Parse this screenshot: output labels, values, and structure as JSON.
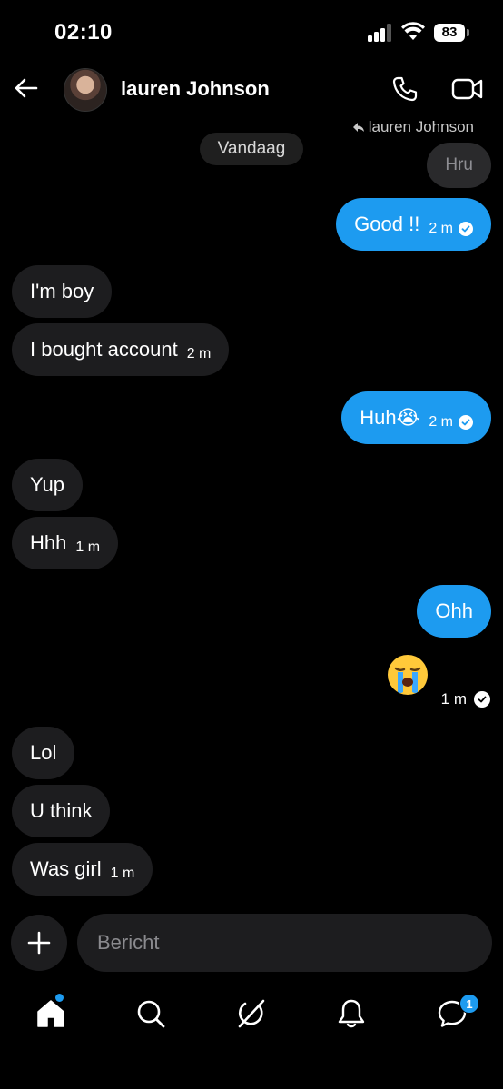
{
  "status": {
    "time": "02:10",
    "battery": "83"
  },
  "header": {
    "name": "lauren Johnson"
  },
  "reply_to": "lauren Johnson",
  "date_separator": "Vandaag",
  "messages": {
    "quoted": "Hru",
    "m1": {
      "text": "Good !!",
      "time": "2 m"
    },
    "m2": {
      "text": "I'm boy"
    },
    "m3": {
      "text": "I bought account",
      "time": "2 m"
    },
    "m4": {
      "text": "Huh😭",
      "time": "2 m"
    },
    "m5": {
      "text": "Yup"
    },
    "m6": {
      "text": "Hhh",
      "time": "1 m"
    },
    "m7": {
      "text": "Ohh"
    },
    "m8": {
      "time": "1 m"
    },
    "m9": {
      "text": "Lol"
    },
    "m10": {
      "text": "U think"
    },
    "m11": {
      "text": "Was girl",
      "time": "1 m"
    }
  },
  "composer": {
    "placeholder": "Bericht"
  },
  "tabs": {
    "items": [
      "home-icon",
      "search-icon",
      "grok-icon",
      "notifications-icon",
      "messages-icon"
    ],
    "messages_badge": "1"
  },
  "colors": {
    "accent": "#1d9bf0",
    "bubble_in": "#1d1d1f",
    "background": "#000000"
  }
}
